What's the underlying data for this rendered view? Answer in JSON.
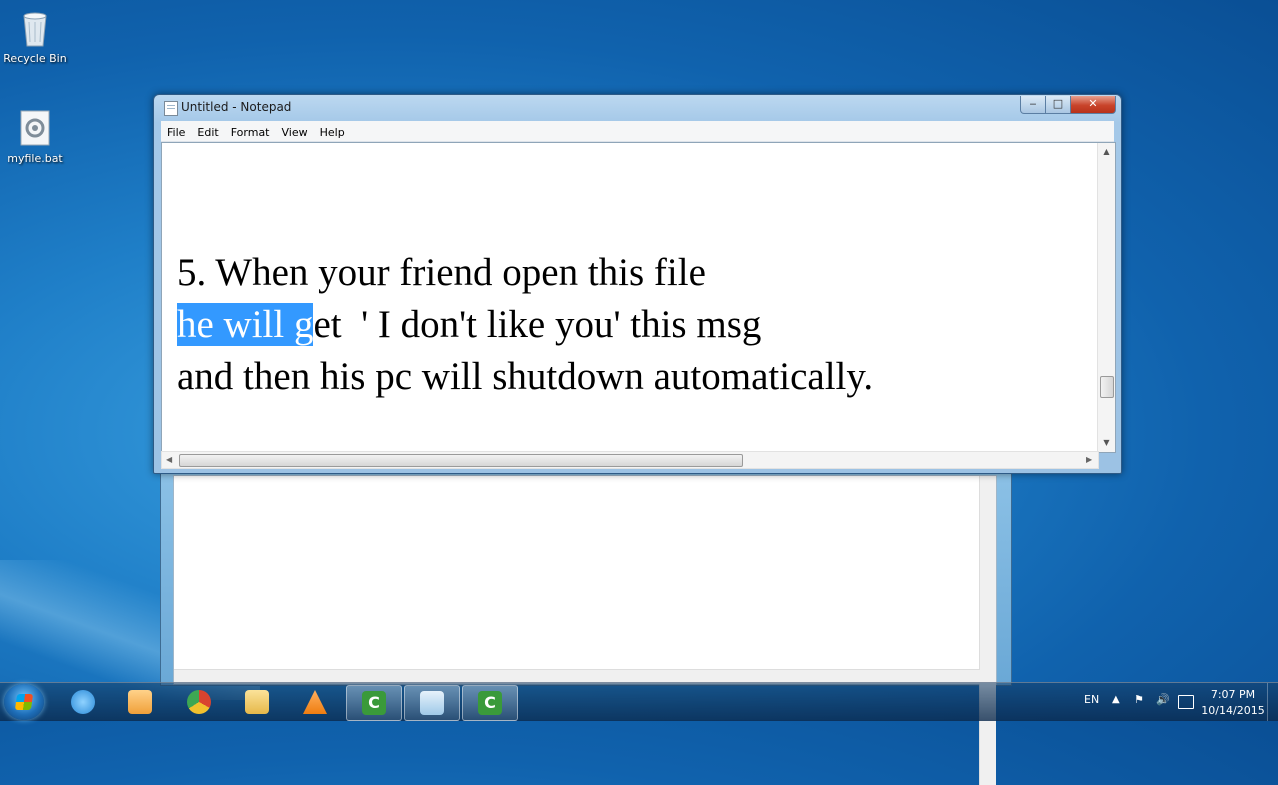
{
  "desktop": {
    "icons": [
      {
        "label": "Recycle Bin",
        "icon": "recycle-bin-icon"
      },
      {
        "label": "myfile.bat",
        "icon": "batch-file-icon"
      }
    ]
  },
  "notepad": {
    "title": "Untitled - Notepad",
    "controls": {
      "minimize": "‒",
      "maximize": "□",
      "close": "✕"
    },
    "menu": [
      "File",
      "Edit",
      "Format",
      "View",
      "Help"
    ],
    "content": {
      "line1": "5. When your friend open this file",
      "line2_selected": "he will g",
      "line2_rest": "et  ' I don't like you' this msg",
      "line3": "and then his pc will shutdown automatically."
    }
  },
  "taskbar": {
    "apps": [
      {
        "name": "Internet Explorer",
        "icon": "internet-explorer-icon",
        "color": "#2a8ad8"
      },
      {
        "name": "Media Player",
        "icon": "media-player-icon",
        "color": "#f0a03a"
      },
      {
        "name": "Google Chrome",
        "icon": "chrome-icon",
        "color": "#d9442f"
      },
      {
        "name": "Windows Explorer",
        "icon": "folder-icon",
        "color": "#f2cf6a"
      },
      {
        "name": "VLC",
        "icon": "vlc-icon",
        "color": "#ef7d10"
      },
      {
        "name": "Camtasia",
        "icon": "camtasia-icon",
        "color": "#3a9a3a",
        "active": true
      },
      {
        "name": "Notepad",
        "icon": "notepad-icon",
        "color": "#9fc9e8",
        "active": true
      },
      {
        "name": "Camtasia Recorder",
        "icon": "camtasia-icon",
        "color": "#3a9a3a",
        "active": true
      }
    ],
    "tray": {
      "language": "EN",
      "time": "7:07 PM",
      "date": "10/14/2015"
    }
  }
}
